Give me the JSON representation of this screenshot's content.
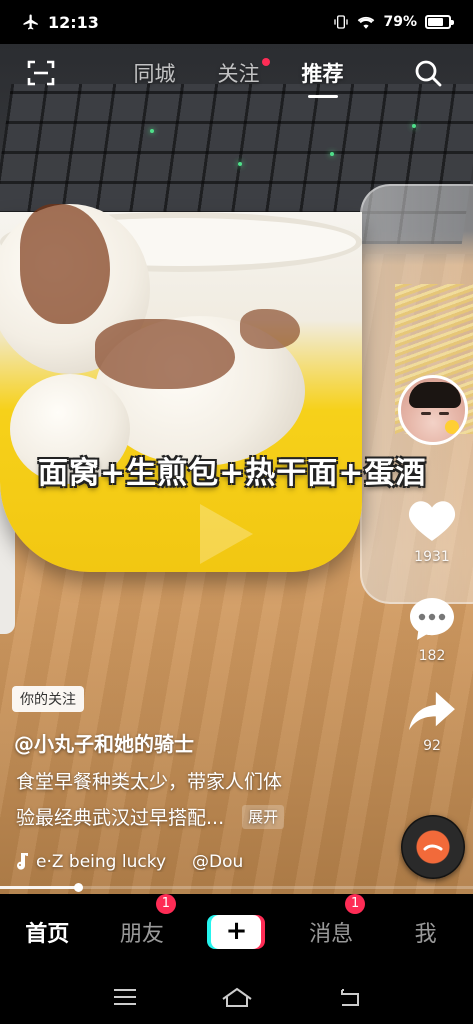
{
  "status_bar": {
    "time": "12:13",
    "battery": "79%",
    "battery_level": 0.79,
    "icons": [
      "airplane-icon",
      "vibrate-icon",
      "wifi-icon",
      "battery-icon"
    ]
  },
  "top_tabs": {
    "items": [
      {
        "label": "同城",
        "active": false,
        "dot": false
      },
      {
        "label": "关注",
        "active": false,
        "dot": true
      },
      {
        "label": "推荐",
        "active": true,
        "dot": false
      }
    ],
    "left_icon": "scan-icon",
    "right_icon": "search-icon"
  },
  "video": {
    "overlay_caption": "面窝+生煎包+热干面+蛋酒"
  },
  "right_rail": {
    "like_count": "1931",
    "comment_count": "182",
    "share_count": "92"
  },
  "info": {
    "follow_badge": "你的关注",
    "author": "@小丸子和她的骑士",
    "desc_line1": "食堂早餐种类太少，带家人们体",
    "desc_line2": "验最经典武汉过早搭配...",
    "expand_label": "展开",
    "music_title": "e·Z being lucky",
    "music_user": "@Dou"
  },
  "progress": 0.165,
  "bottom_nav": {
    "items": [
      {
        "label": "首页",
        "active": true,
        "badge": ""
      },
      {
        "label": "朋友",
        "active": false,
        "badge": "1"
      },
      {
        "label": "+",
        "active": false,
        "badge": ""
      },
      {
        "label": "消息",
        "active": false,
        "badge": "1"
      },
      {
        "label": "我",
        "active": false,
        "badge": ""
      }
    ]
  },
  "colors": {
    "accent_red": "#fe2c55",
    "accent_cyan": "#25f4ee",
    "background": "#000000"
  }
}
